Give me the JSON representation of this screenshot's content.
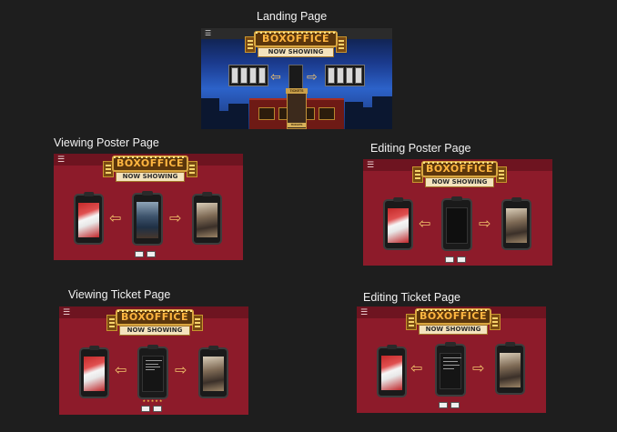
{
  "sections": {
    "landing": {
      "label": "Landing Page"
    },
    "viewing_poster": {
      "label": "Viewing Poster Page"
    },
    "editing_poster": {
      "label": "Editing Poster Page"
    },
    "viewing_ticket": {
      "label": "Viewing Ticket Page"
    },
    "editing_ticket": {
      "label": "Editing Ticket Page"
    }
  },
  "marquee": {
    "title": "BOXOFFICE",
    "subtitle": "NOW SHOWING"
  },
  "booth": {
    "sign": "TICKETS",
    "lower_sign": "TICKETS"
  },
  "menu_icon": "☰",
  "colors": {
    "background": "#1e1e1e",
    "frame_red": "#8d1b2a",
    "marquee_gold": "#ffb640",
    "arrow": "#f2c26b"
  },
  "icons": {
    "menu": "hamburger-icon",
    "left_arrow": "arrow-left-icon",
    "right_arrow": "arrow-right-icon"
  }
}
